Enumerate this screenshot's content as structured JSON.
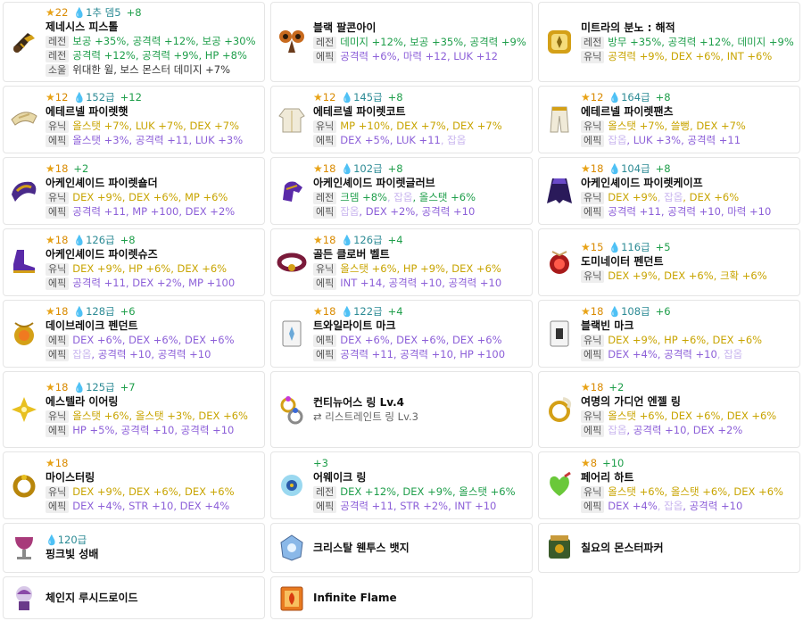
{
  "cards": [
    {
      "name": "제네시스 피스톨",
      "star": "22",
      "drop": "1추 뎀5",
      "plus": "+8",
      "icon": "pistol-icon",
      "rows": [
        {
          "grade": "레전",
          "parts": [
            {
              "t": "보공 +35%",
              "c": "legend"
            },
            {
              "t": ", 공격력 +12%",
              "c": "legend"
            },
            {
              "t": ", 보공 +30%",
              "c": "legend"
            }
          ]
        },
        {
          "grade": "레전",
          "parts": [
            {
              "t": "공격력 +12%",
              "c": "legend"
            },
            {
              "t": ", 공격력 +9%",
              "c": "legend"
            },
            {
              "t": ", HP +8%",
              "c": "legend"
            }
          ]
        },
        {
          "grade": "소울",
          "parts": [
            {
              "t": "위대한 윌, 보스 몬스터 데미지 +7%",
              "c": "dark"
            }
          ]
        }
      ]
    },
    {
      "name": "블랙 팔콘아이",
      "icon": "eye-accessory-icon",
      "rows": [
        {
          "grade": "레전",
          "parts": [
            {
              "t": "데미지 +12%",
              "c": "legend"
            },
            {
              "t": ", 보공 +35%",
              "c": "legend"
            },
            {
              "t": ", 공격력 +9%",
              "c": "legend"
            }
          ]
        },
        {
          "grade": "에픽",
          "parts": [
            {
              "t": "공격력 +6%",
              "c": "epic"
            },
            {
              "t": ", 마력 +12",
              "c": "epic"
            },
            {
              "t": ", LUK +12",
              "c": "epic"
            }
          ]
        }
      ]
    },
    {
      "name": "미트라의 분노 : 해적",
      "icon": "emblem-icon",
      "rows": [
        {
          "grade": "레전",
          "parts": [
            {
              "t": "방무 +35%",
              "c": "legend"
            },
            {
              "t": ", 공격력 +12%",
              "c": "legend"
            },
            {
              "t": ", 데미지 +9%",
              "c": "legend"
            }
          ]
        },
        {
          "grade": "유닉",
          "parts": [
            {
              "t": "공격력 +9%",
              "c": "unique"
            },
            {
              "t": ", DEX +6%",
              "c": "unique"
            },
            {
              "t": ", INT +6%",
              "c": "unique"
            }
          ]
        }
      ]
    },
    {
      "name": "에테르넬 파이렛햇",
      "star": "12",
      "drop": "152급",
      "plus": "+12",
      "icon": "hat-icon",
      "rows": [
        {
          "grade": "유닉",
          "parts": [
            {
              "t": "올스탯 +7%",
              "c": "unique"
            },
            {
              "t": ", LUK +7%",
              "c": "unique"
            },
            {
              "t": ", DEX +7%",
              "c": "unique"
            }
          ]
        },
        {
          "grade": "에픽",
          "parts": [
            {
              "t": "올스탯 +3%",
              "c": "epic"
            },
            {
              "t": ", 공격력 +11",
              "c": "epic"
            },
            {
              "t": ", LUK +3%",
              "c": "epic"
            }
          ]
        }
      ]
    },
    {
      "name": "에테르넬 파이렛코트",
      "star": "12",
      "drop": "145급",
      "plus": "+8",
      "icon": "coat-icon",
      "rows": [
        {
          "grade": "유닉",
          "parts": [
            {
              "t": "MP +10%",
              "c": "unique"
            },
            {
              "t": ", DEX +7%",
              "c": "unique"
            },
            {
              "t": ", DEX +7%",
              "c": "unique"
            }
          ]
        },
        {
          "grade": "에픽",
          "parts": [
            {
              "t": "DEX +5%",
              "c": "epic"
            },
            {
              "t": ", LUK +11",
              "c": "epic"
            },
            {
              "t": ", 잡옵",
              "c": "muted"
            }
          ]
        }
      ]
    },
    {
      "name": "에테르넬 파이렛팬츠",
      "star": "12",
      "drop": "164급",
      "plus": "+8",
      "icon": "pants-icon",
      "rows": [
        {
          "grade": "유닉",
          "parts": [
            {
              "t": "올스탯 +7%",
              "c": "unique"
            },
            {
              "t": ", 쓸뻥",
              "c": "unique"
            },
            {
              "t": ", DEX +7%",
              "c": "unique"
            }
          ]
        },
        {
          "grade": "에픽",
          "parts": [
            {
              "t": "잡옵",
              "c": "muted"
            },
            {
              "t": ", LUK +3%",
              "c": "epic"
            },
            {
              "t": ", 공격력 +11",
              "c": "epic"
            }
          ]
        }
      ]
    },
    {
      "name": "아케인셰이드 파이렛숄더",
      "star": "18",
      "plus": "+2",
      "icon": "shoulder-icon",
      "rows": [
        {
          "grade": "유닉",
          "parts": [
            {
              "t": "DEX +9%",
              "c": "unique"
            },
            {
              "t": ", DEX +6%",
              "c": "unique"
            },
            {
              "t": ", MP +6%",
              "c": "unique"
            }
          ]
        },
        {
          "grade": "에픽",
          "parts": [
            {
              "t": "공격력 +11",
              "c": "epic"
            },
            {
              "t": ", MP +100",
              "c": "epic"
            },
            {
              "t": ", DEX +2%",
              "c": "epic"
            }
          ]
        }
      ]
    },
    {
      "name": "아케인셰이드 파이렛글러브",
      "star": "18",
      "drop": "102급",
      "plus": "+8",
      "icon": "glove-icon",
      "rows": [
        {
          "grade": "레전",
          "parts": [
            {
              "t": "크뎀 +8%",
              "c": "legend"
            },
            {
              "t": ", 잡옵",
              "c": "muted"
            },
            {
              "t": ", 올스탯 +6%",
              "c": "legend"
            }
          ]
        },
        {
          "grade": "에픽",
          "parts": [
            {
              "t": "잡옵",
              "c": "muted"
            },
            {
              "t": ", DEX +2%",
              "c": "epic"
            },
            {
              "t": ", 공격력 +10",
              "c": "epic"
            }
          ]
        }
      ]
    },
    {
      "name": "아케인셰이드 파이렛케이프",
      "star": "18",
      "drop": "104급",
      "plus": "+8",
      "icon": "cape-icon",
      "rows": [
        {
          "grade": "유닉",
          "parts": [
            {
              "t": "DEX +9%",
              "c": "unique"
            },
            {
              "t": ", 잡옵",
              "c": "muted"
            },
            {
              "t": ", DEX +6%",
              "c": "unique"
            }
          ]
        },
        {
          "grade": "에픽",
          "parts": [
            {
              "t": "공격력 +11",
              "c": "epic"
            },
            {
              "t": ", 공격력 +10",
              "c": "epic"
            },
            {
              "t": ", 마력 +10",
              "c": "epic"
            }
          ]
        }
      ]
    },
    {
      "name": "아케인셰이드 파이렛슈즈",
      "star": "18",
      "drop": "126급",
      "plus": "+8",
      "icon": "shoes-icon",
      "rows": [
        {
          "grade": "유닉",
          "parts": [
            {
              "t": "DEX +9%",
              "c": "unique"
            },
            {
              "t": ", HP +6%",
              "c": "unique"
            },
            {
              "t": ", DEX +6%",
              "c": "unique"
            }
          ]
        },
        {
          "grade": "에픽",
          "parts": [
            {
              "t": "공격력 +11",
              "c": "epic"
            },
            {
              "t": ", DEX +2%",
              "c": "epic"
            },
            {
              "t": ", MP +100",
              "c": "epic"
            }
          ]
        }
      ]
    },
    {
      "name": "골든 클로버 벨트",
      "star": "18",
      "drop": "126급",
      "plus": "+4",
      "icon": "belt-icon",
      "rows": [
        {
          "grade": "유닉",
          "parts": [
            {
              "t": "올스탯 +6%",
              "c": "unique"
            },
            {
              "t": ", HP +9%",
              "c": "unique"
            },
            {
              "t": ", DEX +6%",
              "c": "unique"
            }
          ]
        },
        {
          "grade": "에픽",
          "parts": [
            {
              "t": "INT +14",
              "c": "epic"
            },
            {
              "t": ", 공격력 +10",
              "c": "epic"
            },
            {
              "t": ", 공격력 +10",
              "c": "epic"
            }
          ]
        }
      ]
    },
    {
      "name": "도미네이터 펜던트",
      "star": "15",
      "drop": "116급",
      "plus": "+5",
      "icon": "pendant-red-icon",
      "rows": [
        {
          "grade": "유닉",
          "parts": [
            {
              "t": "DEX +9%",
              "c": "unique"
            },
            {
              "t": ", DEX +6%",
              "c": "unique"
            },
            {
              "t": ", 크확 +6%",
              "c": "unique"
            }
          ]
        }
      ]
    },
    {
      "name": "데이브레이크 펜던트",
      "star": "18",
      "drop": "128급",
      "plus": "+6",
      "icon": "pendant-gold-icon",
      "rows": [
        {
          "grade": "에픽",
          "parts": [
            {
              "t": "DEX +6%",
              "c": "epic"
            },
            {
              "t": ", DEX +6%",
              "c": "epic"
            },
            {
              "t": ", DEX +6%",
              "c": "epic"
            }
          ]
        },
        {
          "grade": "에픽",
          "parts": [
            {
              "t": "잡옵",
              "c": "muted"
            },
            {
              "t": ", 공격력 +10",
              "c": "epic"
            },
            {
              "t": ", 공격력 +10",
              "c": "epic"
            }
          ]
        }
      ]
    },
    {
      "name": "트와일라이트 마크",
      "star": "18",
      "drop": "122급",
      "plus": "+4",
      "icon": "mark-icon",
      "rows": [
        {
          "grade": "에픽",
          "parts": [
            {
              "t": "DEX +6%",
              "c": "epic"
            },
            {
              "t": ", DEX +6%",
              "c": "epic"
            },
            {
              "t": ", DEX +6%",
              "c": "epic"
            }
          ]
        },
        {
          "grade": "에픽",
          "parts": [
            {
              "t": "공격력 +11",
              "c": "epic"
            },
            {
              "t": ", 공격력 +10",
              "c": "epic"
            },
            {
              "t": ", HP +100",
              "c": "epic"
            }
          ]
        }
      ]
    },
    {
      "name": "블랙빈 마크",
      "star": "18",
      "drop": "108급",
      "plus": "+6",
      "icon": "mark-dark-icon",
      "rows": [
        {
          "grade": "유닉",
          "parts": [
            {
              "t": "DEX +9%",
              "c": "unique"
            },
            {
              "t": ", HP +6%",
              "c": "unique"
            },
            {
              "t": ", DEX +6%",
              "c": "unique"
            }
          ]
        },
        {
          "grade": "에픽",
          "parts": [
            {
              "t": "DEX +4%",
              "c": "epic"
            },
            {
              "t": ", 공격력 +10",
              "c": "epic"
            },
            {
              "t": ", 잡옵",
              "c": "muted"
            }
          ]
        }
      ]
    },
    {
      "name": "에스텔라 이어링",
      "star": "18",
      "drop": "125급",
      "plus": "+7",
      "icon": "earring-icon",
      "rows": [
        {
          "grade": "유닉",
          "parts": [
            {
              "t": "올스탯 +6%",
              "c": "unique"
            },
            {
              "t": ", 올스탯 +3%",
              "c": "unique"
            },
            {
              "t": ", DEX +6%",
              "c": "unique"
            }
          ]
        },
        {
          "grade": "에픽",
          "parts": [
            {
              "t": "HP +5%",
              "c": "epic"
            },
            {
              "t": ", 공격력 +10",
              "c": "epic"
            },
            {
              "t": ", 공격력 +10",
              "c": "epic"
            }
          ]
        }
      ]
    },
    {
      "name": "컨티뉴어스 링 Lv.4",
      "sub": "⇄ 리스트레인트 링 Lv.3",
      "icon": "ring-continuous-icon",
      "rows": []
    },
    {
      "name": "여명의 가디언 엔젤 링",
      "star": "18",
      "plus": "+2",
      "icon": "ring-angel-icon",
      "rows": [
        {
          "grade": "유닉",
          "parts": [
            {
              "t": "올스탯 +6%",
              "c": "unique"
            },
            {
              "t": ", DEX +6%",
              "c": "unique"
            },
            {
              "t": ", DEX +6%",
              "c": "unique"
            }
          ]
        },
        {
          "grade": "에픽",
          "parts": [
            {
              "t": "잡옵",
              "c": "muted"
            },
            {
              "t": ", 공격력 +10",
              "c": "epic"
            },
            {
              "t": ", DEX +2%",
              "c": "epic"
            }
          ]
        }
      ]
    },
    {
      "name": "마이스터링",
      "star": "18",
      "icon": "ring-meister-icon",
      "rows": [
        {
          "grade": "유닉",
          "parts": [
            {
              "t": "DEX +9%",
              "c": "unique"
            },
            {
              "t": ", DEX +6%",
              "c": "unique"
            },
            {
              "t": ", DEX +6%",
              "c": "unique"
            }
          ]
        },
        {
          "grade": "에픽",
          "parts": [
            {
              "t": "DEX +4%",
              "c": "epic"
            },
            {
              "t": ", STR +10",
              "c": "epic"
            },
            {
              "t": ", DEX +4%",
              "c": "epic"
            }
          ]
        }
      ]
    },
    {
      "name": "어웨이크 링",
      "plus": "+3",
      "icon": "ring-awake-icon",
      "rows": [
        {
          "grade": "레전",
          "parts": [
            {
              "t": "DEX +12%",
              "c": "legend"
            },
            {
              "t": ", DEX +9%",
              "c": "legend"
            },
            {
              "t": ", 올스탯 +6%",
              "c": "legend"
            }
          ]
        },
        {
          "grade": "에픽",
          "parts": [
            {
              "t": "공격력 +11",
              "c": "epic"
            },
            {
              "t": ", STR +2%",
              "c": "epic"
            },
            {
              "t": ", INT +10",
              "c": "epic"
            }
          ]
        }
      ]
    },
    {
      "name": "페어리 하트",
      "star": "8",
      "plus": "+10",
      "icon": "heart-icon",
      "rows": [
        {
          "grade": "유닉",
          "parts": [
            {
              "t": "올스탯 +6%",
              "c": "unique"
            },
            {
              "t": ", 올스탯 +6%",
              "c": "unique"
            },
            {
              "t": ", DEX +6%",
              "c": "unique"
            }
          ]
        },
        {
          "grade": "에픽",
          "parts": [
            {
              "t": "DEX +4%",
              "c": "epic"
            },
            {
              "t": ", 잡옵",
              "c": "muted"
            },
            {
              "t": ", 공격력 +10",
              "c": "epic"
            }
          ]
        }
      ]
    },
    {
      "name": "핑크빛 성배",
      "drop": "120급",
      "icon": "chalice-icon",
      "rows": []
    },
    {
      "name": "크리스탈 웬투스 뱃지",
      "icon": "badge-icon",
      "rows": []
    },
    {
      "name": "칠요의 몬스터파커",
      "icon": "medal-icon",
      "rows": []
    },
    {
      "name": "체인지 루시드로이드",
      "icon": "android-icon",
      "rows": []
    },
    {
      "name": "Infinite Flame",
      "icon": "flame-book-icon",
      "rows": []
    }
  ]
}
